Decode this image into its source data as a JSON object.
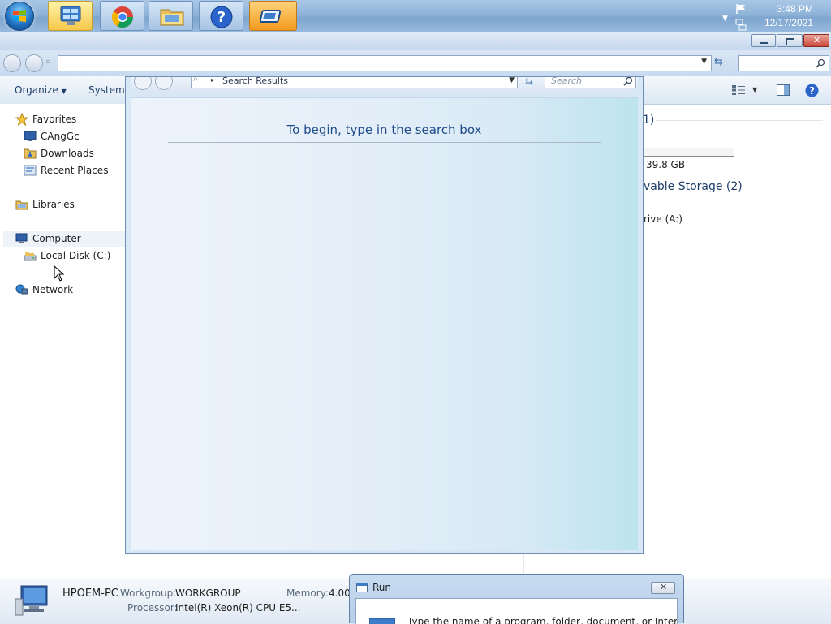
{
  "taskbar": {
    "buttons": [
      "start-orb",
      "server-manager",
      "chrome",
      "explorer",
      "help",
      "window-switcher"
    ],
    "clock": {
      "time": "3:48 PM",
      "date": "12/17/2021"
    }
  },
  "explorer": {
    "command_bar": {
      "organize": "Organize",
      "system": "System p"
    },
    "nav": {
      "favorites": "Favorites",
      "favorites_items": [
        "CAngGc",
        "Downloads",
        "Recent Places"
      ],
      "libraries": "Libraries",
      "computer": "Computer",
      "computer_items": [
        "Local Disk (C:)"
      ],
      "network": "Network"
    },
    "content": {
      "heading_fragment_1": "1)",
      "disk_free": "39.8 GB",
      "removable_heading": "vable Storage (2)",
      "floppy": "rive (A:)"
    }
  },
  "search_window": {
    "breadcrumb": "Search Results",
    "search_placeholder": "Search",
    "message": "To begin, type in the search box"
  },
  "details": {
    "computer_name": "HPOEM-PC",
    "workgroup_label": "Workgroup:",
    "workgroup_value": "WORKGROUP",
    "memory_label": "Memory:",
    "memory_value": "4.00",
    "processor_label": "Processor:",
    "processor_value": "Intel(R) Xeon(R) CPU E5..."
  },
  "run_dialog": {
    "title": "Run",
    "text": "Type the name of a program, folder, document, or Internet"
  },
  "colors": {
    "accent": "#1e4c8a",
    "taskbar": "#8fb3d8"
  }
}
